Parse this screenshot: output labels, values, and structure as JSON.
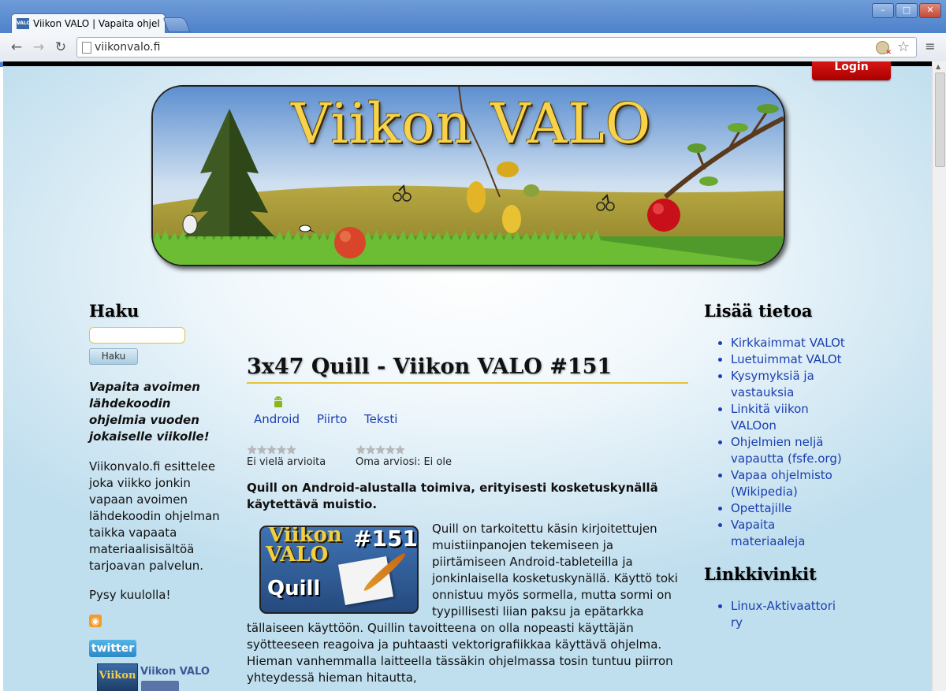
{
  "browser": {
    "tab_title": "Viikon VALO | Vapaita ohjelmia",
    "tab_favicon": "VALO",
    "url": "viikonvalo.fi",
    "icons": [
      "back-icon",
      "forward-icon",
      "reload-icon",
      "page-icon",
      "star-icon",
      "menu-icon"
    ]
  },
  "page": {
    "login_label": "Login",
    "banner_title": "Viikon VALO",
    "search": {
      "heading": "Haku",
      "button_label": "Haku",
      "placeholder": ""
    },
    "tagline": "Vapaita avoimen lähdekoodin ohjelmia vuoden jokaiselle viikolle!",
    "intro": "Viikonvalo.fi esittelee joka viikko jonkin vapaan avoimen lähdekoodin ohjelman taikka vapaata materiaalisisältöä tarjoavan palvelun.",
    "stay_tuned": "Pysy kuulolla!",
    "twitter_label": "twitter",
    "fb": {
      "thumb_text": "Viikon",
      "name": "Viikon VALO"
    },
    "post": {
      "title": "3x47 Quill - Viikon VALO #151",
      "tags": [
        "Android",
        "Piirto",
        "Teksti"
      ],
      "rating_left": "Ei vielä arvioita",
      "rating_right": "Oma arviosi: Ei ole",
      "lead": "Quill on Android-alustalla toimiva, erityisesti kosketuskynällä käytettävä muistio.",
      "image": {
        "line1": "Viikon",
        "line2": "VALO",
        "number": "#151",
        "name": "Quill"
      },
      "body": "Quill on tarkoitettu käsin kirjoitettujen muistiinpanojen tekemiseen ja piirtämiseen Android-tableteilla ja jonkinlaisella kosketuskynällä. Käyttö toki onnistuu myös sormella, mutta sormi on tyypillisesti liian paksu ja epätarkka tällaiseen käyttöön. Quillin tavoitteena on olla nopeasti käyttäjän syötteeseen reagoiva ja puhtaasti vektorigrafiikkaa käyttävä ohjelma. Hieman vanhemmalla laitteella tässäkin ohjelmassa tosin tuntuu piirron yhteydessä hieman hitautta,"
    },
    "right": {
      "heading1": "Lisää tietoa",
      "links1": [
        "Kirkkaimmat VALOt",
        "Luetuimmat VALOt",
        "Kysymyksiä ja vastauksia",
        "Linkitä viikon VALOon",
        "Ohjelmien neljä vapautta (fsfe.org)",
        "Vapaa ohjelmisto (Wikipedia)",
        "Opettajille",
        "Vapaita materiaaleja"
      ],
      "heading2": "Linkkivinkit",
      "links2": [
        "Linux-Aktivaattori ry"
      ]
    }
  }
}
